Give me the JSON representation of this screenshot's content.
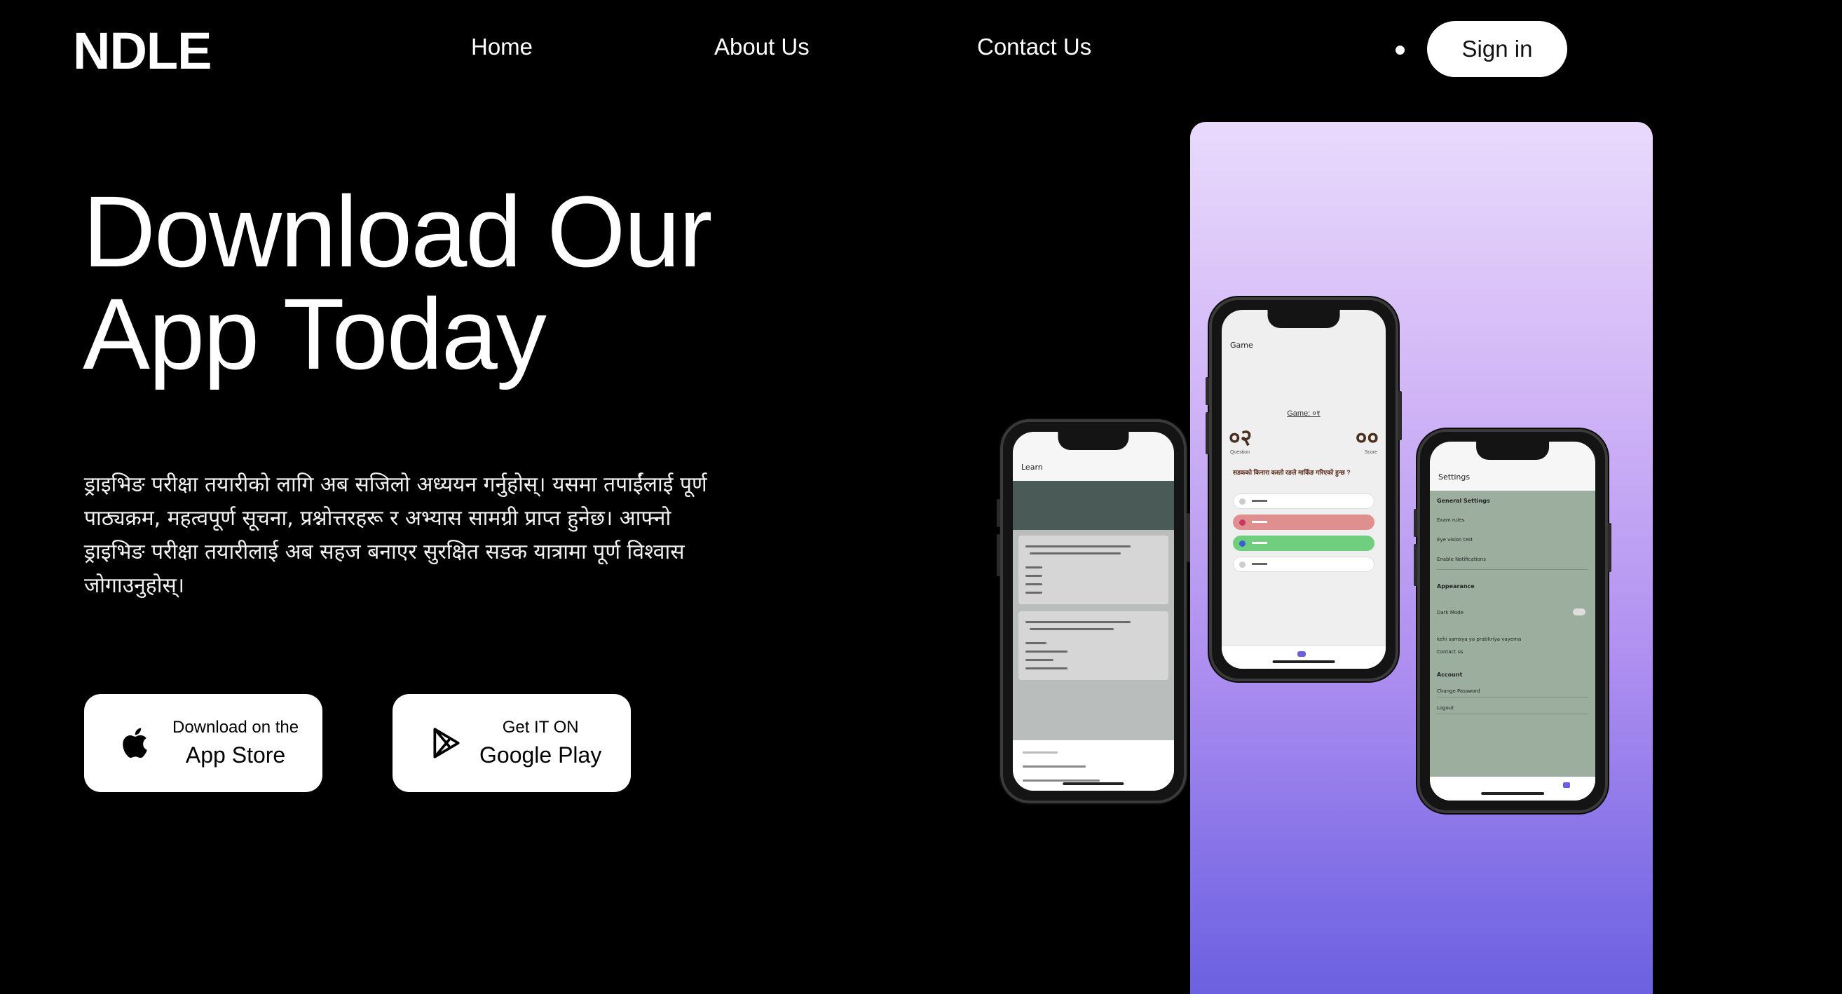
{
  "brand": {
    "logo": "NDLE"
  },
  "nav": {
    "items": [
      {
        "label": "Home"
      },
      {
        "label": "About Us"
      },
      {
        "label": "Contact Us"
      }
    ],
    "sign_in": "Sign in"
  },
  "hero": {
    "title_line1": "Download Our",
    "title_line2": "App Today",
    "description": "ड्राइभिङ परीक्षा तयारीको लागि अब सजिलो अध्ययन गर्नुहोस्। यसमा तपाईंलाई पूर्ण पाठ्यक्रम, महत्वपूर्ण सूचना, प्रश्नोत्तरहरू र अभ्यास सामग्री प्राप्त हुनेछ। आफ्नो ड्राइभिङ परीक्षा तयारीलाई अब सहज बनाएर सुरक्षित सडक यात्रामा पूर्ण विश्वास जोगाउनुहोस्।"
  },
  "stores": {
    "apple": {
      "small": "Download on the",
      "big": "App Store",
      "icon": "apple-icon"
    },
    "google": {
      "small": "Get IT ON",
      "big": "Google Play",
      "icon": "google-play-icon"
    }
  },
  "phones": {
    "learn": {
      "screen_title": "Learn"
    },
    "game": {
      "screen_title": "Game",
      "game_label": "Game: ०१",
      "question_num": "०२",
      "question_label": "Question",
      "score_num": "००",
      "score_label": "Score",
      "question_text": "सडकको किनारा कस्तो रङले मार्किङ गरिएको हुन्छ ?"
    },
    "settings": {
      "screen_title": "Settings",
      "general_header": "General Settings",
      "exam_rules": "Exam rules",
      "eye_test": "Eye vision test",
      "notifications": "Enable Notifications",
      "appearance_header": "Appearance",
      "dark_mode": "Dark Mode",
      "feedback": "kehi samsya ya pratikriya vayema",
      "contact": "Contact us",
      "account_header": "Account",
      "change_password": "Change Password",
      "logout": "Logout"
    }
  },
  "colors": {
    "background": "#000000",
    "panel_top": "#e9dafc",
    "panel_bottom": "#6a5fe0",
    "correct_option": "#6fcf7f",
    "wrong_option": "#e08f8f",
    "settings_green": "#9caf9e"
  }
}
